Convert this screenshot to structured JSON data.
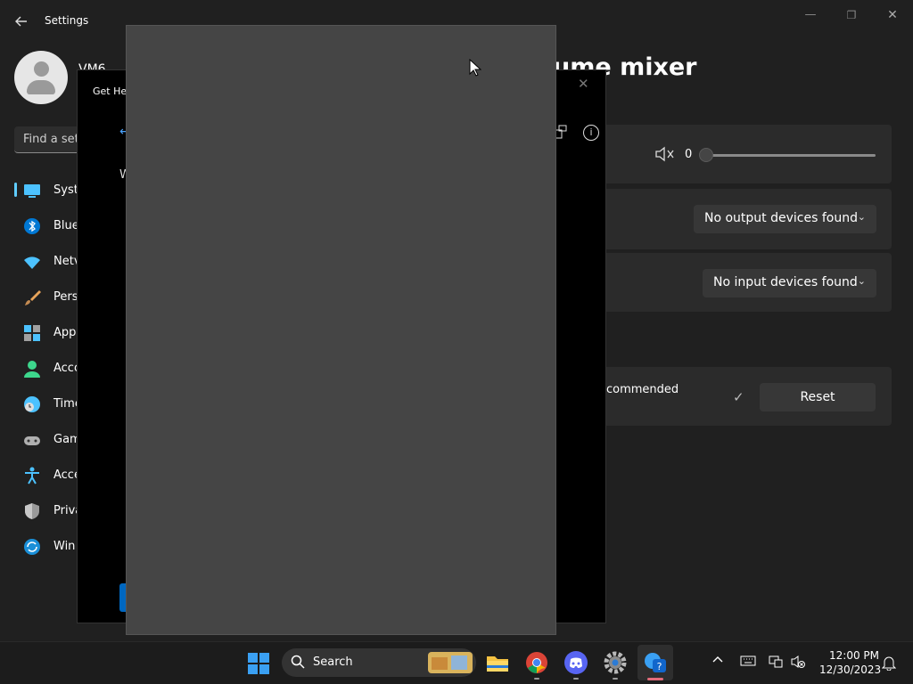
{
  "window": {
    "title": "Settings",
    "back_icon": "back-arrow-icon",
    "min_icon": "—",
    "max_icon": "❐",
    "close_icon": "✕"
  },
  "user": {
    "name": "VM6"
  },
  "search": {
    "placeholder": "Find a set"
  },
  "nav": {
    "items": [
      {
        "label": "Syste",
        "icon": "system-icon"
      },
      {
        "label": "Blue",
        "icon": "bluetooth-icon"
      },
      {
        "label": "Netv",
        "icon": "network-icon"
      },
      {
        "label": "Pers",
        "icon": "brush-icon"
      },
      {
        "label": "App",
        "icon": "apps-icon"
      },
      {
        "label": "Acco",
        "icon": "accounts-icon"
      },
      {
        "label": "Time",
        "icon": "time-icon"
      },
      {
        "label": "Gam",
        "icon": "gaming-icon"
      },
      {
        "label": "Acce",
        "icon": "accessibility-icon"
      },
      {
        "label": "Priva",
        "icon": "privacy-icon"
      },
      {
        "label": "Win",
        "icon": "update-icon"
      }
    ]
  },
  "main": {
    "title": "ume mixer",
    "volume": {
      "value": "0",
      "level": 0
    },
    "output_dropdown": "No output devices found",
    "input_dropdown": "No input devices found",
    "reset_row": {
      "text": "commended",
      "button": "Reset"
    }
  },
  "gethelp": {
    "title": "Get Hel",
    "text": "W"
  },
  "taskbar": {
    "search_label": "Search",
    "apps": [
      "start-icon",
      "file-explorer-icon",
      "chrome-icon",
      "discord-icon",
      "settings-icon",
      "get-help-icon"
    ],
    "clock_time": "12:00 PM",
    "clock_date": "12/30/2023"
  },
  "colors": {
    "accent": "#60cdff",
    "background": "#202020",
    "card": "#2b2b2b",
    "overlay": "#454545",
    "help_underline": "#e26b7a"
  }
}
